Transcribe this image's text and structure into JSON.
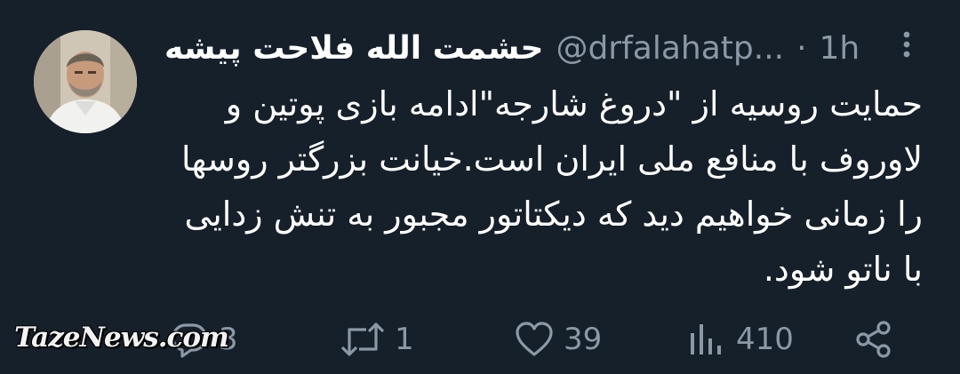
{
  "tweet": {
    "author_name": "حشمت الله فلاحت پیشه",
    "handle": "@drfalahatp...",
    "separator": "·",
    "time": "1h",
    "lines": [
      "حمایت روسیه از \"دروغ شارجه\"ادامه بازی پوتین و",
      "لاوروف با منافع ملی ایران است.خیانت بزرگتر روسها",
      "را زمانی خواهیم دید که دیکتاتور مجبور به تنش زدایی",
      "با ناتو شود."
    ]
  },
  "actions": {
    "reply_count": "3",
    "retweet_count": "1",
    "like_count": "39",
    "views_count": "410"
  },
  "icons": {
    "more": "more-vertical-icon",
    "reply": "reply-icon",
    "retweet": "retweet-icon",
    "like": "heart-icon",
    "views": "views-icon",
    "share": "share-icon"
  },
  "watermark": "TazeNews.com",
  "colors": {
    "background": "#16202b",
    "text": "#ffffff",
    "muted": "#8b98a5"
  }
}
